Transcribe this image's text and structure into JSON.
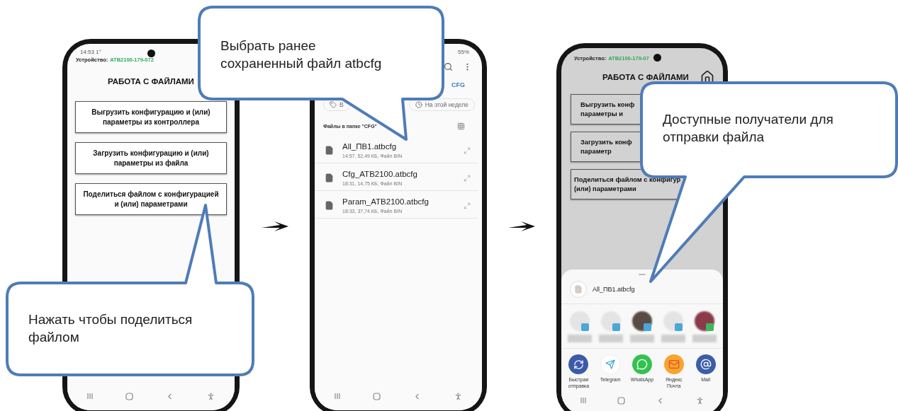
{
  "phones": [
    {
      "kind": "app_menu",
      "status_time": "14:53 1°",
      "device_label": "Устройство:",
      "device_id": "ATB2100-179-072",
      "title": "РАБОТА С ФАЙЛАМИ",
      "buttons": [
        "Выгрузить конфигурацию и (или) параметры из контроллера",
        "Загрузить конфигурацию и (или) параметры из файла",
        "Поделиться файлом с конфигурацией и (или) параметрами"
      ]
    },
    {
      "kind": "file_picker",
      "battery": "55%",
      "breadcrumb": "CFG",
      "chips": [
        "В",
        "На этой неделе"
      ],
      "folder_label": "Файлы в папке \"CFG\"",
      "files": [
        {
          "name": "All_ПВ1.atbcfg",
          "meta": "14:57, 52,49 КБ, Файл BIN"
        },
        {
          "name": "Cfg_ATB2100.atbcfg",
          "meta": "18:31, 14,75 КБ, Файл BIN"
        },
        {
          "name": "Param_ATB2100.atbcfg",
          "meta": "18:33, 37,74 КБ, Файл BIN"
        }
      ]
    },
    {
      "kind": "share_sheet",
      "device_label": "Устройство:",
      "device_id": "ATB2100-179-07",
      "title": "РАБОТА С ФАЙЛАМИ",
      "buttons": [
        "Выгрузить конф\nпараметры и",
        "Загрузить конф\nпараметр",
        "Поделиться файлом с конфигур\n(или) параметрами"
      ],
      "file_name": "All_ПВ1.atbcfg",
      "apps": [
        {
          "kind": "quick_share",
          "label": "Быстрая отправка"
        },
        {
          "kind": "telegram",
          "label": "Telegram"
        },
        {
          "kind": "whatsapp",
          "label": "WhatsApp"
        },
        {
          "kind": "yandex_mail",
          "label": "Яндекс Почта"
        },
        {
          "kind": "mail",
          "label": "Mail"
        }
      ]
    }
  ],
  "callouts": [
    {
      "text": "Выбрать ранее\nсохраненный файл atbcfg"
    },
    {
      "text": "Нажать чтобы поделиться\nфайлом"
    },
    {
      "text": "Доступные получатели для\nотправки файла"
    }
  ]
}
